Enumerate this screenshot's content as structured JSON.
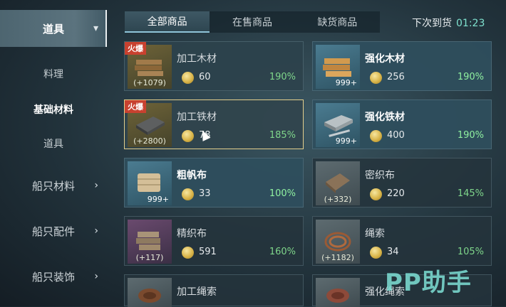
{
  "sidebar": {
    "items": [
      {
        "label": "道具",
        "chevron": "▾",
        "active": true
      },
      {
        "label": "料理"
      },
      {
        "label": "基础材料",
        "selected": true
      },
      {
        "label": "道具"
      },
      {
        "label": "船只材料",
        "chevron": "›"
      },
      {
        "label": "船只配件",
        "chevron": "›"
      },
      {
        "label": "船只装饰",
        "chevron": "›"
      }
    ]
  },
  "tabs": [
    "全部商品",
    "在售商品",
    "缺货商品"
  ],
  "restock": {
    "label": "下次到货",
    "time": "01:23"
  },
  "badge_hot": "火爆",
  "products": [
    {
      "name": "加工木材",
      "price": "60",
      "pct": "190%",
      "qty": "(+1079)",
      "hot": true
    },
    {
      "name": "强化木材",
      "price": "256",
      "pct": "190%",
      "qty": "999+"
    },
    {
      "name": "加工铁材",
      "price": "78",
      "pct": "185%",
      "qty": "(+2800)",
      "hot": true
    },
    {
      "name": "强化铁材",
      "price": "400",
      "pct": "190%",
      "qty": "999+"
    },
    {
      "name": "粗帆布",
      "price": "33",
      "pct": "100%",
      "qty": "999+"
    },
    {
      "name": "密织布",
      "price": "220",
      "pct": "145%",
      "qty": "(+332)"
    },
    {
      "name": "精织布",
      "price": "591",
      "pct": "160%",
      "qty": "(+117)"
    },
    {
      "name": "绳索",
      "price": "34",
      "pct": "105%",
      "qty": "(+1182)"
    },
    {
      "name": "加工绳索",
      "price": "",
      "pct": "",
      "qty": ""
    },
    {
      "name": "强化绳索",
      "price": "",
      "pct": "",
      "qty": ""
    }
  ],
  "watermark": "PP助手",
  "colors": {
    "accent_green": "#7fd68b",
    "timer": "#7fe2cf",
    "hot_red": "#c8412f",
    "selected_border": "#e4cf8c"
  }
}
